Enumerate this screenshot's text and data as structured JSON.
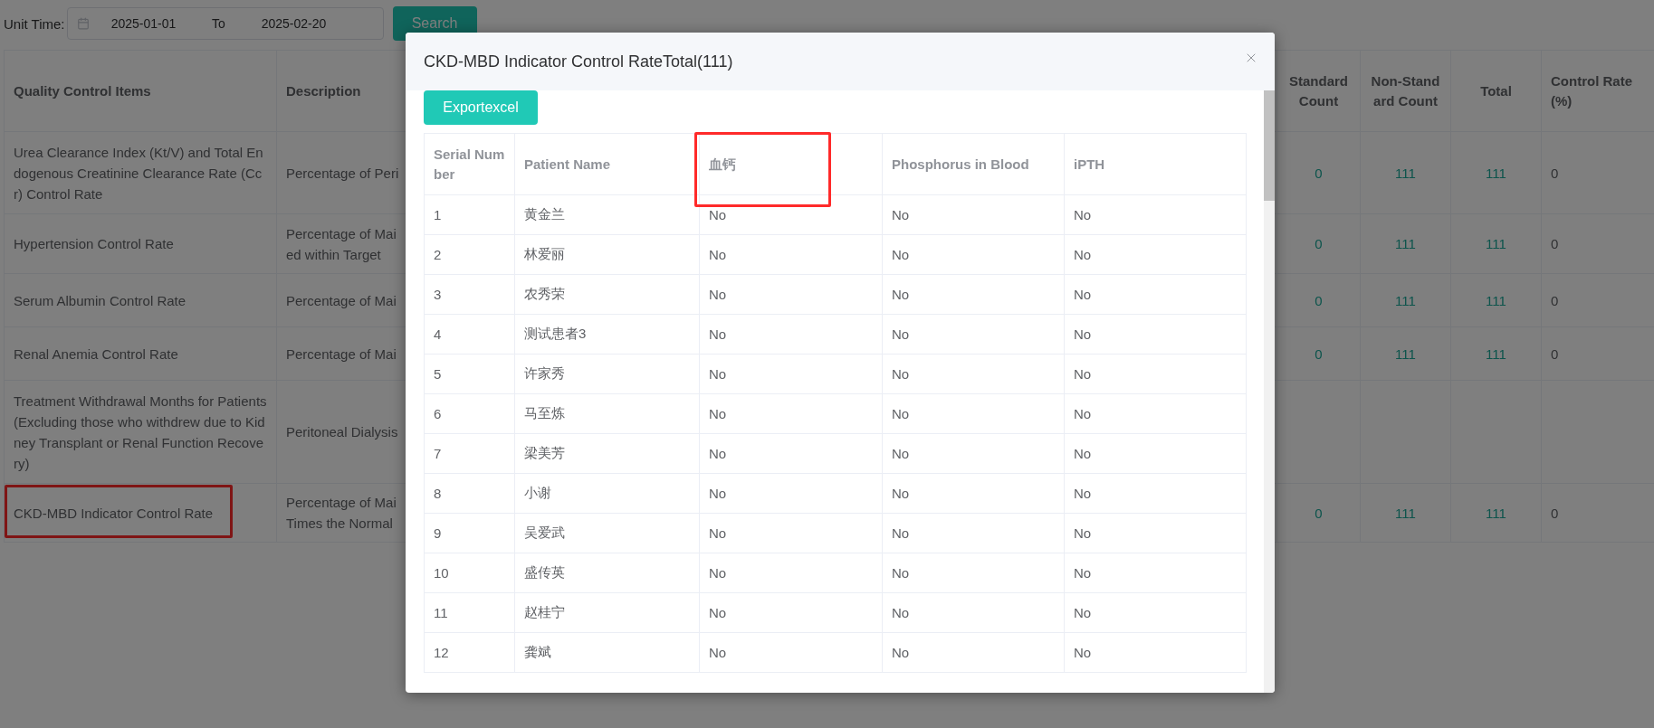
{
  "filter": {
    "label": "Unit Time:",
    "start": "2025-01-01",
    "separator": "To",
    "end": "2025-02-20"
  },
  "search_button": "Search",
  "table": {
    "columns": [
      {
        "label": "Quality Control Items",
        "kind": "text"
      },
      {
        "label": "Description",
        "kind": "text"
      },
      {
        "label": "Standard Count",
        "kind": "count"
      },
      {
        "label": "Non-Standard Count",
        "kind": "count"
      },
      {
        "label": "Total",
        "kind": "count"
      },
      {
        "label": "Control Rate (%)",
        "kind": "plain"
      }
    ],
    "rows": [
      {
        "cells": [
          "Urea Clearance Index (Kt/V) and Total Endogenous Creatinine Clearance Rate (Ccr) Control Rate",
          "Percentage of Peri",
          "0",
          "111",
          "111",
          "0"
        ],
        "highlighted": false
      },
      {
        "cells": [
          "Hypertension Control Rate",
          "Percentage of Mai\ned within Target",
          "0",
          "111",
          "111",
          "0"
        ],
        "highlighted": false
      },
      {
        "cells": [
          "Serum Albumin Control Rate",
          "Percentage of Mai",
          "0",
          "111",
          "111",
          "0"
        ],
        "highlighted": false
      },
      {
        "cells": [
          "Renal Anemia Control Rate",
          "Percentage of Mai",
          "0",
          "111",
          "111",
          "0"
        ],
        "highlighted": false
      },
      {
        "cells": [
          "Treatment Withdrawal Months for Patients (Excluding those who withdrew due to Kidney Transplant or Renal Function Recovery)",
          "Peritoneal Dialysis",
          null,
          null,
          null,
          null
        ],
        "highlighted": false
      },
      {
        "cells": [
          "CKD-MBD Indicator Control Rate",
          "Percentage of Mai\nTimes the Normal",
          "0",
          "111",
          "111",
          "0"
        ],
        "highlighted": true
      }
    ]
  },
  "modal": {
    "title": "CKD-MBD Indicator Control RateTotal(111)",
    "export_button": "Exportexcel",
    "columns": [
      {
        "label": "Serial Number",
        "highlighted": false
      },
      {
        "label": "Patient Name",
        "highlighted": false
      },
      {
        "label": "血钙",
        "highlighted": true
      },
      {
        "label": "Phosphorus in Blood",
        "highlighted": false
      },
      {
        "label": "iPTH",
        "highlighted": false
      }
    ],
    "rows": [
      [
        "1",
        "黄金兰",
        "No",
        "No",
        "No"
      ],
      [
        "2",
        "林爱丽",
        "No",
        "No",
        "No"
      ],
      [
        "3",
        "农秀荣",
        "No",
        "No",
        "No"
      ],
      [
        "4",
        "测试患者3",
        "No",
        "No",
        "No"
      ],
      [
        "5",
        "许家秀",
        "No",
        "No",
        "No"
      ],
      [
        "6",
        "马至炼",
        "No",
        "No",
        "No"
      ],
      [
        "7",
        "梁美芳",
        "No",
        "No",
        "No"
      ],
      [
        "8",
        "小谢",
        "No",
        "No",
        "No"
      ],
      [
        "9",
        "吴爱武",
        "No",
        "No",
        "No"
      ],
      [
        "10",
        "盛传英",
        "No",
        "No",
        "No"
      ],
      [
        "11",
        "赵桂宁",
        "No",
        "No",
        "No"
      ],
      [
        "12",
        "龚斌",
        "No",
        "No",
        "No"
      ]
    ]
  }
}
